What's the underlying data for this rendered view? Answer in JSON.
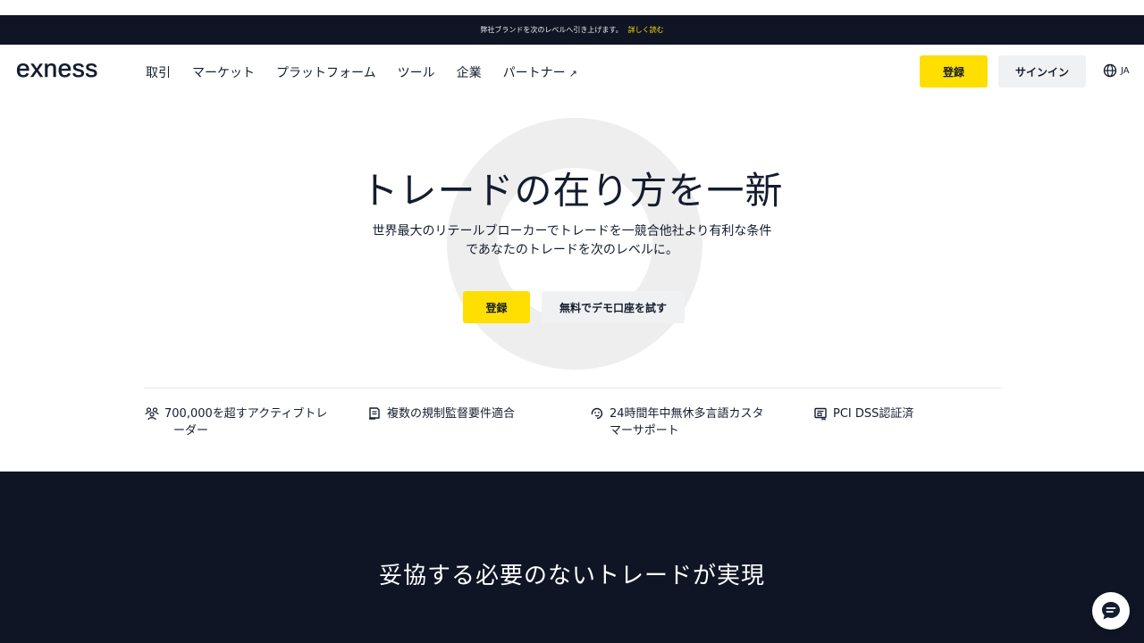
{
  "promo": {
    "text": "弊社ブランドを次のレベルへ引き上げます。",
    "link": "詳しく読む"
  },
  "brand": {
    "logo": "exness"
  },
  "nav": {
    "items": [
      "取引",
      "マーケット",
      "プラットフォーム",
      "ツール",
      "企業",
      "パートナー"
    ],
    "partner_arrow": "↗",
    "register_label": "登録",
    "signin_label": "サインイン",
    "lang_label": "JA",
    "lang_icon": "globe-icon"
  },
  "hero": {
    "title": "トレードの在り方を一新",
    "subtitle_line1": "世界最大のリテールブローカーでトレードを一競合他社より有利な条件",
    "subtitle_line2": "であなたのトレードを次のレベルに。",
    "register_label": "登録",
    "demo_label": "無料でデモ口座を試す"
  },
  "features": [
    {
      "icon": "users-icon",
      "line1": "700,000を超すアクティブトレ",
      "line2": "ーダー"
    },
    {
      "icon": "document-icon",
      "line1": "複数の規制監督要件適合",
      "line2": ""
    },
    {
      "icon": "headset-icon",
      "line1": "24時間年中無休多言語カスタ",
      "line2": "マーサポート"
    },
    {
      "icon": "card-icon",
      "line1": "PCI DSS認証済",
      "line2": ""
    }
  ],
  "section2": {
    "title": "妥協する必要のないトレードが実現"
  },
  "chat": {
    "icon": "chat-icon"
  },
  "colors": {
    "accent": "#ffde02",
    "dark": "#0f1524",
    "text": "#141d2f"
  }
}
